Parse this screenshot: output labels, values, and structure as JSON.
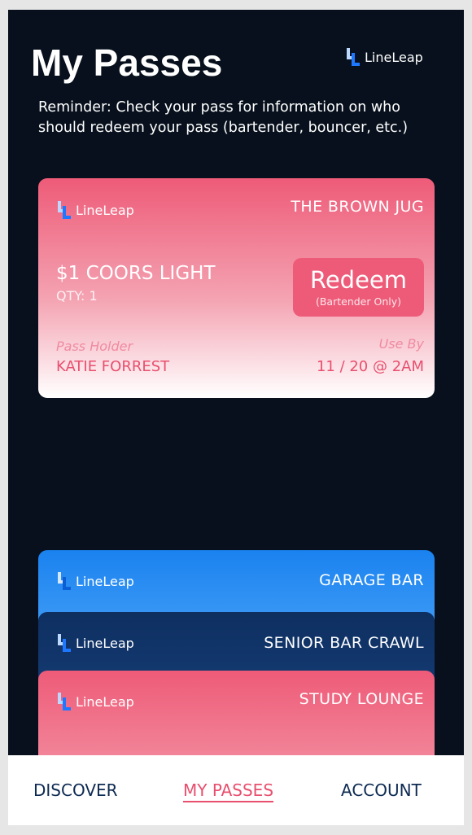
{
  "header": {
    "title": "My Passes",
    "brand": "LineLeap"
  },
  "reminder": "Reminder: Check your pass for information on who should redeem your pass (bartender, bouncer, etc.)",
  "active_pass": {
    "brand": "LineLeap",
    "venue": "THE BROWN JUG",
    "item": "$1 COORS LIGHT",
    "qty": "QTY: 1",
    "redeem_label": "Redeem",
    "redeem_sub": "(Bartender Only)",
    "holder_label": "Pass Holder",
    "holder_name": "KATIE FORREST",
    "use_by_label": "Use By",
    "use_by_value": "11 / 20 @ 2AM"
  },
  "stacked_passes": [
    {
      "brand": "LineLeap",
      "venue": "GARAGE BAR"
    },
    {
      "brand": "LineLeap",
      "venue": "SENIOR BAR CRAWL"
    },
    {
      "brand": "LineLeap",
      "venue": "STUDY LOUNGE"
    }
  ],
  "nav": {
    "discover": "DISCOVER",
    "my_passes": "MY PASSES",
    "account": "ACCOUNT"
  },
  "colors": {
    "pink": "#ee5b78",
    "blue": "#1a82ef",
    "navy": "#0e2f60",
    "background": "#07101c",
    "nav_text": "#0d2a52"
  },
  "icons": {
    "brand_logo": "lineleap-logo-icon"
  }
}
